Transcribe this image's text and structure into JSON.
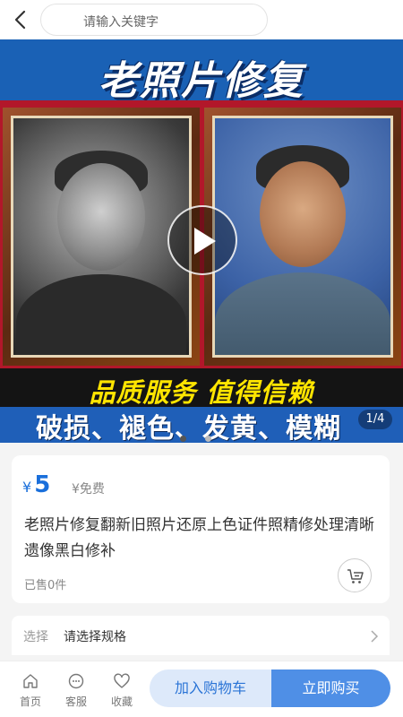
{
  "search": {
    "placeholder": "请输入关键字"
  },
  "banner": {
    "title": "老照片修复",
    "slogan": "品质服务 值得信赖",
    "problems": "破损、褪色、发黄、模糊",
    "pager": "1/4",
    "current_slide": 1,
    "total_slides": 4,
    "dots": 2
  },
  "product": {
    "currency": "¥",
    "price": "5",
    "free_tag": "¥免费",
    "title": "老照片修复翻新旧照片还原上色证件照精修处理清晰遗像黑白修补",
    "sold": "已售0件"
  },
  "spec": {
    "label": "选择",
    "value": "请选择规格"
  },
  "bottom_nav": {
    "home": "首页",
    "service": "客服",
    "favorite": "收藏",
    "add_to_cart": "加入购物车",
    "buy_now": "立即购买"
  },
  "colors": {
    "accent": "#4f8fe6",
    "price": "#1a6fdb",
    "slogan": "#ffe500"
  }
}
